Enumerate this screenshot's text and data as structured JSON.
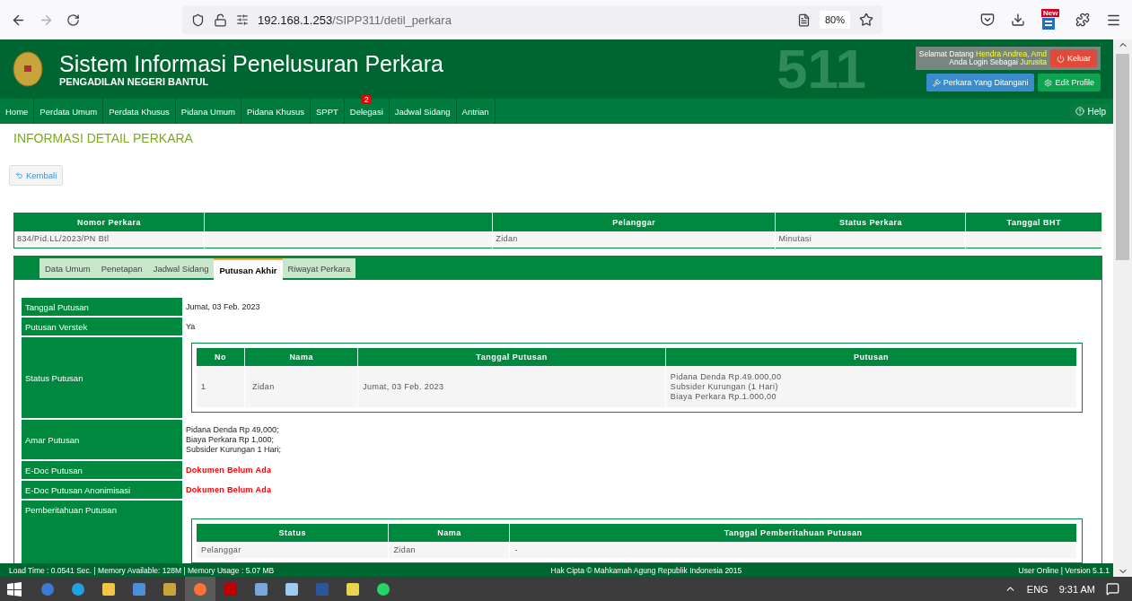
{
  "browser": {
    "url_host": "192.168.1.253",
    "url_path": "/SIPP311/detil_perkara",
    "zoom": "80%",
    "extension_badge": "New"
  },
  "header": {
    "title": "Sistem Informasi Penelusuran Perkara",
    "subtitle": "PENGADILAN NEGERI BANTUL",
    "background_number": "511",
    "user": {
      "greeting": "Selamat Datang",
      "name": "Hendra Andrea, Amd",
      "role_prefix": "Anda Login Sebagai",
      "role": "Jurusita"
    },
    "logout_button": "Keluar",
    "cases_button": "Perkara Yang Ditangani",
    "profile_button": "Edit Profile",
    "help_button": "Help"
  },
  "nav": [
    {
      "label": "Home"
    },
    {
      "label": "Perdata Umum"
    },
    {
      "label": "Perdata Khusus"
    },
    {
      "label": "Pidana Umum"
    },
    {
      "label": "Pidana Khusus"
    },
    {
      "label": "SPPT"
    },
    {
      "label": "Delegasi",
      "badge": "2"
    },
    {
      "label": "Jadwal Sidang"
    },
    {
      "label": "Antrian"
    }
  ],
  "page_title": "INFORMASI DETAIL PERKARA",
  "back_button": "Kembali",
  "case_table": {
    "columns": [
      {
        "label": "Nomor Perkara"
      },
      {},
      {
        "label": "Pelanggar"
      },
      {
        "label": "Status Perkara"
      },
      {
        "label": "Tanggal BHT"
      }
    ],
    "rows": [
      [
        "834/Pid.LL/2023/PN Btl",
        null,
        "Zidan",
        "Minutasi",
        null
      ]
    ]
  },
  "tabs": [
    {
      "label": "Data Umum",
      "selected": false
    },
    {
      "label": "Penetapan",
      "selected": false
    },
    {
      "label": "Jadwal Sidang",
      "selected": false
    },
    {
      "label": "Putusan Akhir",
      "selected": true
    },
    {
      "label": "Riwayat Perkara",
      "selected": false
    }
  ],
  "details": [
    {
      "label": "Tanggal Putusan",
      "kind": "text",
      "value": "Jumat, 03 Feb. 2023"
    },
    {
      "label": "Putusan Verstek",
      "kind": "text",
      "value": "Ya"
    },
    {
      "label": "Status Putusan",
      "kind": "table",
      "table": {
        "columns": [
          "No",
          "Nama",
          "Tanggal Putusan",
          "Putusan"
        ],
        "rows": [
          [
            "1",
            "Zidan",
            "Jumat, 03 Feb. 2023",
            "Pidana Denda Rp.49.000,00\nSubsider Kurungan (1 Hari)\nBiaya Perkara Rp.1.000,00"
          ]
        ]
      }
    },
    {
      "label": "Amar Putusan",
      "kind": "text",
      "value": "Pidana Denda Rp 49,000;\nBiaya Perkara Rp 1,000;\nSubsider Kurungan 1 Hari;"
    },
    {
      "label": "E-Doc Putusan",
      "kind": "alert",
      "value": "Dokumen Belum Ada"
    },
    {
      "label": "E-Doc Putusan Anonimisasi",
      "kind": "alert",
      "value": "Dokumen Belum Ada"
    },
    {
      "label": "Pemberitahuan Putusan",
      "kind": "notice_table",
      "table": {
        "columns": [
          "Status",
          "Nama",
          "Tanggal Pemberitahuan Putusan"
        ],
        "rows": [
          [
            "Pelanggar",
            "Zidan",
            "-"
          ]
        ]
      }
    }
  ],
  "footer": {
    "stats": "Load Time : 0.0541 Sec. | Memory Available: 128M | Memory Usage : 5.07 MB",
    "copyright": "Hak Cipta © Mahkamah Agung Republik Indonesia 2015",
    "version": "User Online | Version 5.1.1"
  },
  "taskbar": {
    "apps": [
      {
        "kind": "cortana",
        "selected": false
      },
      {
        "kind": "edge",
        "selected": false
      },
      {
        "kind": "folder",
        "selected": false
      },
      {
        "kind": "panel",
        "selected": false
      },
      {
        "kind": "network",
        "selected": false
      },
      {
        "kind": "firefox",
        "selected": true
      },
      {
        "kind": "filezilla",
        "selected": false
      },
      {
        "kind": "scanner",
        "selected": false
      },
      {
        "kind": "notepad",
        "selected": false
      },
      {
        "kind": "word",
        "selected": false
      },
      {
        "kind": "notes",
        "selected": false
      },
      {
        "kind": "whatsapp",
        "selected": false
      }
    ],
    "language": "ENG",
    "time": "9:31 AM"
  }
}
